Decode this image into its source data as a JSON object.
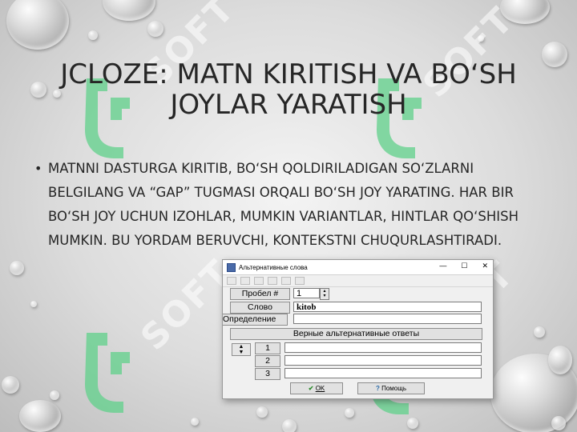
{
  "slide": {
    "title": "JCLOZE: MATN KIRITISH VA BO‘SH JOYLAR YARATISH",
    "bullet": "MATNNI DASTURGA KIRITIB, BO‘SH QOLDIRILADIGAN SO‘ZLARNI BELGILANG VA “GAP” TUGMASI ORQALI BO‘SH JOY YARATING. HAR BIR BO‘SH JOY UCHUN IZOHLAR, MUMKIN VARIANTLAR, HINTLAR QO‘SHISH MUMKIN. BU YORDAM BERUVCHI, KONTEKSTNI CHUQURLASHTIRADI.",
    "watermark": "SOFT"
  },
  "dialog": {
    "title": "Альтернативные слова",
    "window_controls": [
      "—",
      "☐",
      "✕"
    ],
    "gap_label": "Пробел #",
    "gap_value": "1",
    "word_label": "Слово",
    "word_value": "kitob",
    "definition_label": "Определение",
    "definition_value": "",
    "alternatives_header": "Верные альтернативные ответы",
    "rows": [
      {
        "num": "1",
        "value": ""
      },
      {
        "num": "2",
        "value": ""
      },
      {
        "num": "3",
        "value": ""
      }
    ],
    "ok_label": "OK",
    "help_label": "Помощь"
  },
  "colors": {
    "text": "#262626",
    "watermark_green": "#5fd08a"
  }
}
